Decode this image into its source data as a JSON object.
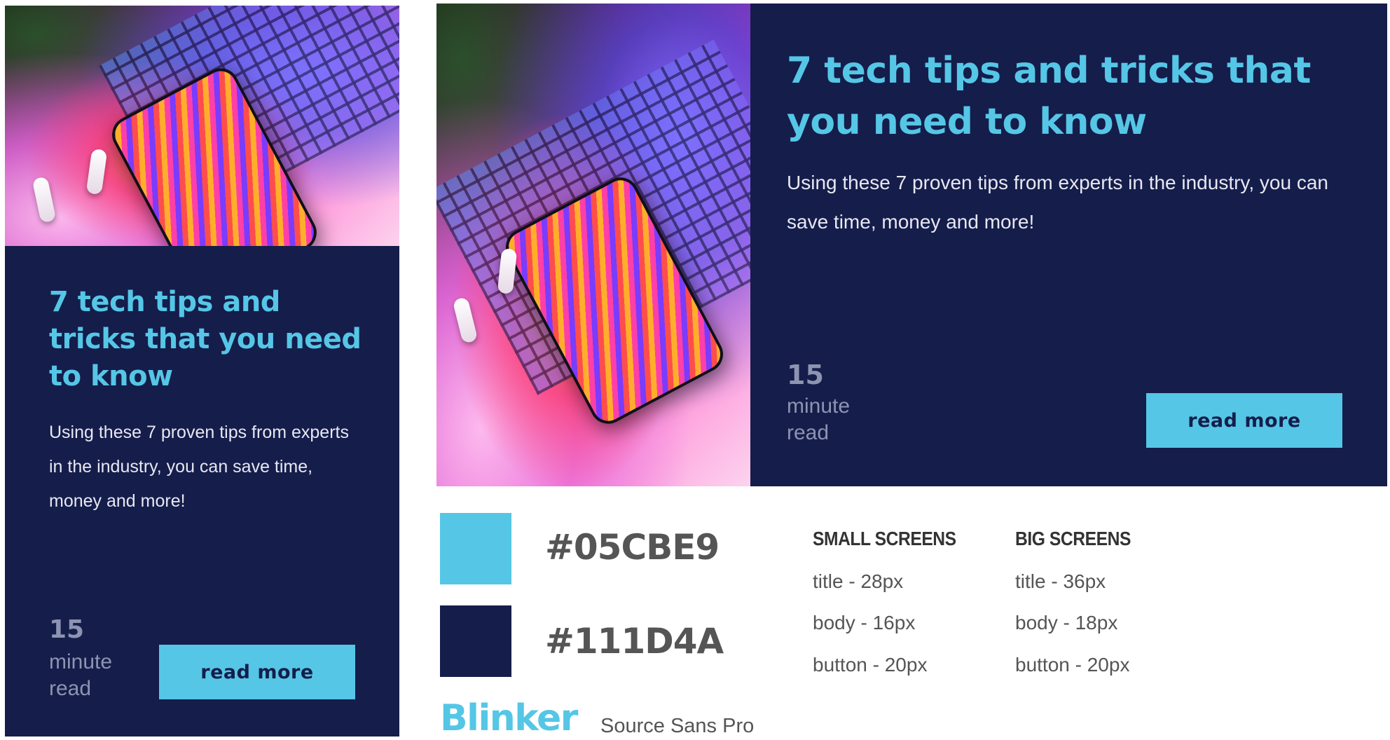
{
  "cards": [
    {
      "title": "7 tech tips and tricks that you need to know",
      "body": "Using these 7 proven tips from experts in the industry, you can save time, money and more!",
      "read_time_number": "15",
      "read_time_unit_1": "minute",
      "read_time_unit_2": "read",
      "button_label": "read more"
    },
    {
      "title": "7 tech tips and tricks that you need to know",
      "body": "Using these 7 proven tips from experts in the industry, you can save time, money and more!",
      "read_time_number": "15",
      "read_time_unit_1": "minute",
      "read_time_unit_2": "read",
      "button_label": "read more"
    }
  ],
  "palette": {
    "accent": "#05CBE9",
    "dark": "#111D4A"
  },
  "specs": {
    "small": {
      "heading": "SMALL SCREENS",
      "title": "title - 28px",
      "body": "body - 16px",
      "button": "button - 20px"
    },
    "big": {
      "heading": "BIG SCREENS",
      "title": "title - 36px",
      "body": "body - 18px",
      "button": "button - 20px"
    }
  },
  "fonts": {
    "heading_font": "Blinker",
    "body_font": "Source Sans Pro"
  }
}
